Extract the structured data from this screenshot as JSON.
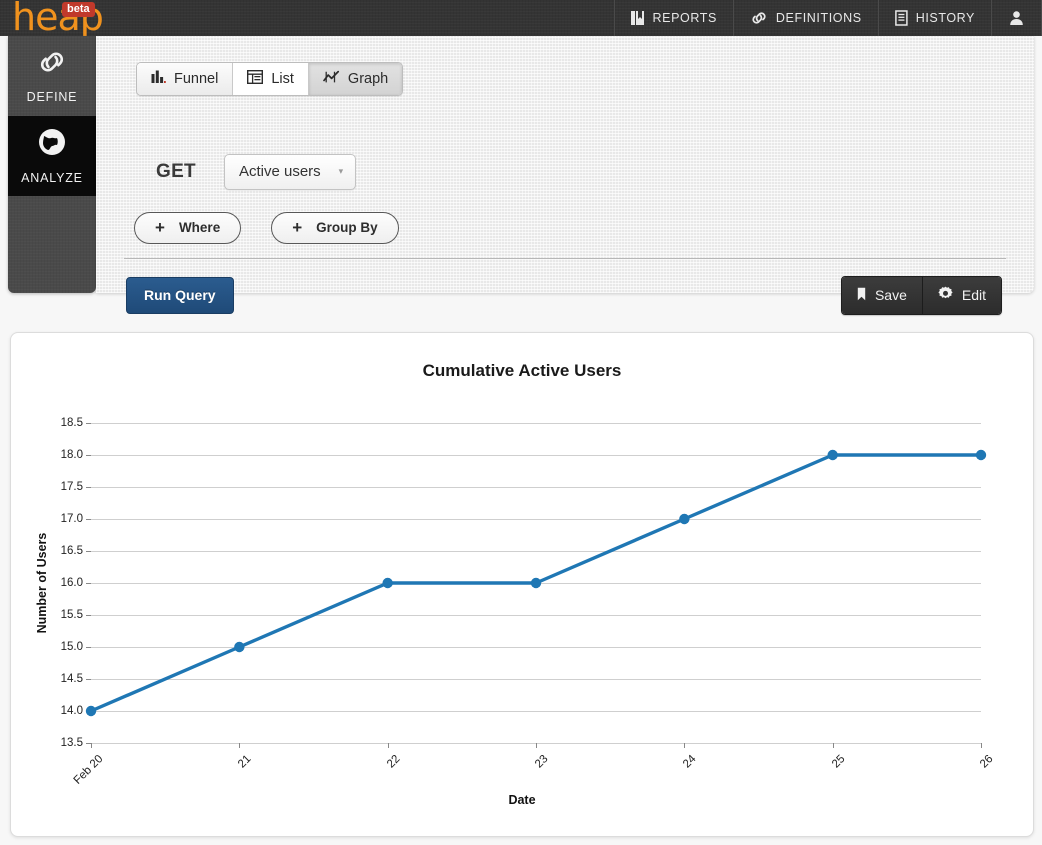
{
  "topbar": {
    "logo": "heap",
    "badge": "beta",
    "nav": [
      {
        "label": "REPORTS",
        "icon": "reports-book-icon"
      },
      {
        "label": "DEFINITIONS",
        "icon": "link-chain-icon"
      },
      {
        "label": "HISTORY",
        "icon": "history-document-icon"
      },
      {
        "label": "",
        "icon": "user-account-icon"
      }
    ]
  },
  "sidebar": {
    "items": [
      {
        "label": "DEFINE",
        "icon": "link-chain-icon",
        "active": false
      },
      {
        "label": "ANALYZE",
        "icon": "globe-icon",
        "active": true
      }
    ]
  },
  "query": {
    "tabs": [
      {
        "label": "Funnel",
        "icon": "bar-chart-icon",
        "active": false
      },
      {
        "label": "List",
        "icon": "table-list-icon",
        "active": false
      },
      {
        "label": "Graph",
        "icon": "line-chart-icon",
        "active": true
      }
    ],
    "get_label": "GET",
    "metric_select": {
      "value": "Active users",
      "caret": "▾"
    },
    "where_button": {
      "plus": "+",
      "label": "Where"
    },
    "groupby_button": {
      "plus": "+",
      "label": "Group By"
    },
    "run_button": "Run Query",
    "save_button": "Save",
    "edit_button": "Edit"
  },
  "chart_data": {
    "type": "line",
    "title": "Cumulative Active Users",
    "xlabel": "Date",
    "ylabel": "Number of Users",
    "categories": [
      "Feb 20",
      "21",
      "22",
      "23",
      "24",
      "25",
      "26"
    ],
    "values": [
      14.0,
      15.0,
      16.0,
      16.0,
      17.0,
      18.0,
      18.0
    ],
    "yticks": [
      "18.5",
      "18.0",
      "17.5",
      "17.0",
      "16.5",
      "16.0",
      "15.5",
      "15.0",
      "14.5",
      "14.0",
      "13.5"
    ],
    "ylim": [
      13.5,
      18.5
    ],
    "grid": true,
    "legend": "none",
    "series_color": "#1f77b4",
    "marker": "circle"
  }
}
